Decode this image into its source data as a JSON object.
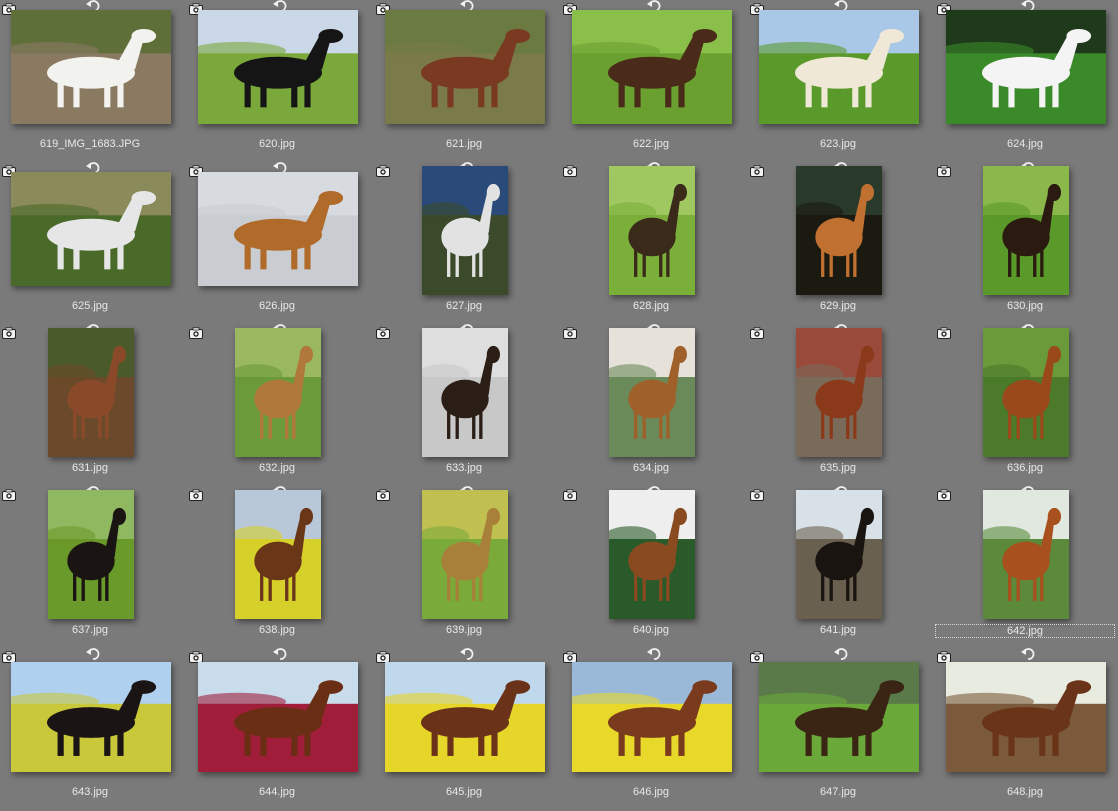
{
  "thumbnails": [
    {
      "file": "619_IMG_1683.JPG",
      "bg": "#8a7a62",
      "sky": "#5f6f3a",
      "horse": "#f2f2ee",
      "orient": "land"
    },
    {
      "file": "620.jpg",
      "bg": "#7aa83a",
      "sky": "#c9d7e6",
      "horse": "#151515",
      "orient": "land"
    },
    {
      "file": "621.jpg",
      "bg": "#7a7a4a",
      "sky": "#6a7a40",
      "horse": "#7a3a22",
      "orient": "land"
    },
    {
      "file": "622.jpg",
      "bg": "#6aa030",
      "sky": "#8abf4a",
      "horse": "#4a2a18",
      "orient": "land"
    },
    {
      "file": "623.jpg",
      "bg": "#5a9a2a",
      "sky": "#a9c8e8",
      "horse": "#efe8d6",
      "orient": "land"
    },
    {
      "file": "624.jpg",
      "bg": "#3a8a2a",
      "sky": "#1e3a1a",
      "horse": "#f4f4f4",
      "orient": "land"
    },
    {
      "file": "625.jpg",
      "bg": "#4a6a2a",
      "sky": "#8a8a5a",
      "horse": "#e6e6e6",
      "orient": "land"
    },
    {
      "file": "626.jpg",
      "bg": "#c9cdd2",
      "sky": "#d7dbe0",
      "horse": "#b06a2a",
      "orient": "land"
    },
    {
      "file": "627.jpg",
      "bg": "#3a4a2a",
      "sky": "#2a4a7a",
      "horse": "#e2e2e2",
      "orient": "port"
    },
    {
      "file": "628.jpg",
      "bg": "#7ab03a",
      "sky": "#a0c860",
      "horse": "#3a2a1a",
      "orient": "port"
    },
    {
      "file": "629.jpg",
      "bg": "#1a1a10",
      "sky": "#2a3a2a",
      "horse": "#c07030",
      "orient": "port"
    },
    {
      "file": "630.jpg",
      "bg": "#5a9a2a",
      "sky": "#8ab84a",
      "horse": "#2a1a10",
      "orient": "port"
    },
    {
      "file": "631.jpg",
      "bg": "#6a4a2a",
      "sky": "#4a5a2a",
      "horse": "#8a4a2a",
      "orient": "port"
    },
    {
      "file": "632.jpg",
      "bg": "#6a9a3a",
      "sky": "#9ab860",
      "horse": "#b0783a",
      "orient": "port"
    },
    {
      "file": "633.jpg",
      "bg": "#c8c8c8",
      "sky": "#dedede",
      "horse": "#2a1e16",
      "orient": "port"
    },
    {
      "file": "634.jpg",
      "bg": "#6a8a5a",
      "sky": "#e6e2da",
      "horse": "#a0602a",
      "orient": "port"
    },
    {
      "file": "635.jpg",
      "bg": "#7a6a5a",
      "sky": "#9a4a3a",
      "horse": "#8a3a1a",
      "orient": "port"
    },
    {
      "file": "636.jpg",
      "bg": "#4a7a2a",
      "sky": "#6a9a3a",
      "horse": "#9a4a1a",
      "orient": "port"
    },
    {
      "file": "637.jpg",
      "bg": "#6a9a2a",
      "sky": "#90b860",
      "horse": "#1a1412",
      "orient": "port"
    },
    {
      "file": "638.jpg",
      "bg": "#d6d02a",
      "sky": "#b8c8d8",
      "horse": "#6a3618",
      "orient": "port"
    },
    {
      "file": "639.jpg",
      "bg": "#7aaa3a",
      "sky": "#c0c050",
      "horse": "#a8803a",
      "orient": "port"
    },
    {
      "file": "640.jpg",
      "bg": "#2a5a2a",
      "sky": "#eeeeee",
      "horse": "#8a4a20",
      "orient": "port"
    },
    {
      "file": "641.jpg",
      "bg": "#6a6050",
      "sky": "#d8e0e8",
      "horse": "#1a1410",
      "orient": "port"
    },
    {
      "file": "642.jpg",
      "bg": "#5a8a3a",
      "sky": "#e0e8e0",
      "horse": "#a8501e",
      "orient": "port"
    },
    {
      "file": "643.jpg",
      "bg": "#c8c83a",
      "sky": "#b0d0f0",
      "horse": "#1a1414",
      "orient": "land"
    },
    {
      "file": "644.jpg",
      "bg": "#a01e3a",
      "sky": "#c8dcec",
      "horse": "#6a2e14",
      "orient": "land"
    },
    {
      "file": "645.jpg",
      "bg": "#e6d62a",
      "sky": "#c0d8ec",
      "horse": "#6a3218",
      "orient": "land"
    },
    {
      "file": "646.jpg",
      "bg": "#e8d82a",
      "sky": "#9ab8d8",
      "horse": "#7a3a1e",
      "orient": "land"
    },
    {
      "file": "647.jpg",
      "bg": "#6aa83a",
      "sky": "#5a7a4a",
      "horse": "#3a2414",
      "orient": "land"
    },
    {
      "file": "648.jpg",
      "bg": "#7a5a3a",
      "sky": "#e8ece0",
      "horse": "#6a3418",
      "orient": "land"
    }
  ],
  "selected_index": 23
}
